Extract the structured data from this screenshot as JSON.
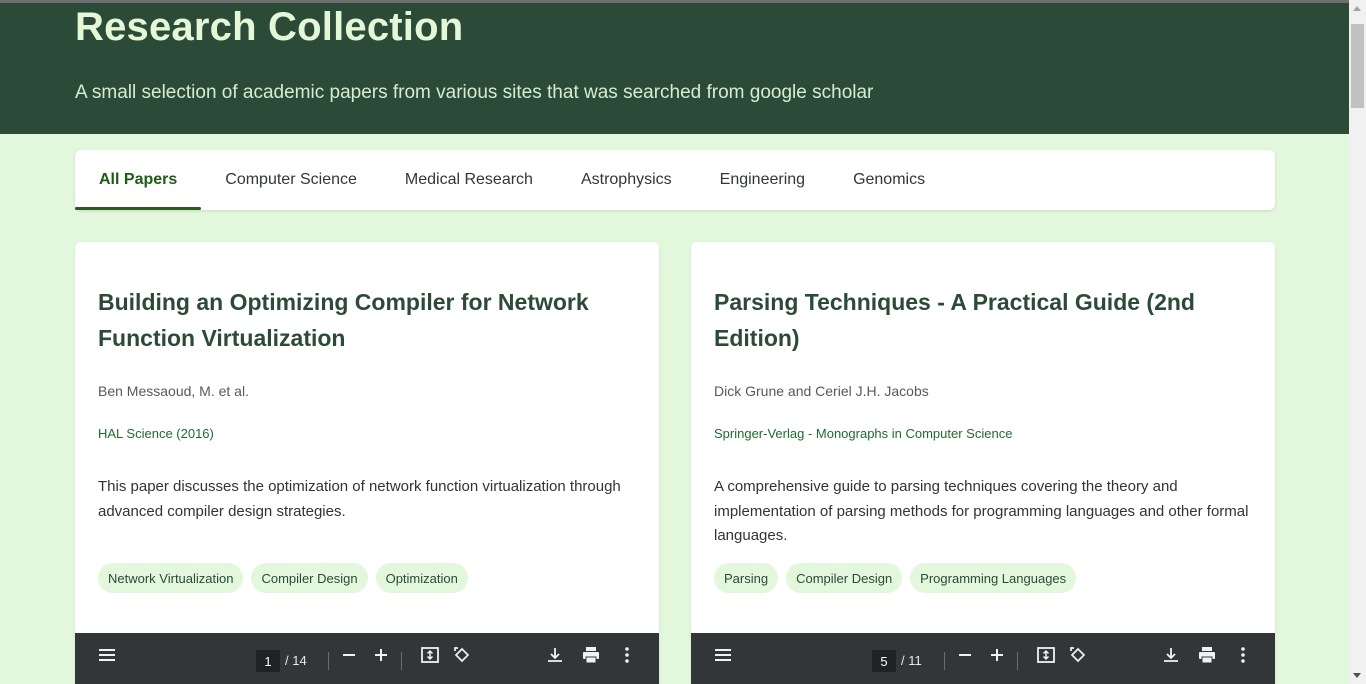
{
  "header": {
    "title": "Research Collection",
    "subtitle": "A small selection of academic papers from various sites that was searched from google scholar"
  },
  "tabs": [
    {
      "label": "All Papers",
      "active": true
    },
    {
      "label": "Computer Science"
    },
    {
      "label": "Medical Research"
    },
    {
      "label": "Astrophysics"
    },
    {
      "label": "Engineering"
    },
    {
      "label": "Genomics"
    }
  ],
  "papers": [
    {
      "title": "Building an Optimizing Compiler for Network Function Virtualization",
      "authors": "Ben Messaoud, M. et al.",
      "source": "HAL Science (2016)",
      "abstract": "This paper discusses the optimization of network function virtualization through advanced compiler design strategies.",
      "tags": [
        "Network Virtualization",
        "Compiler Design",
        "Optimization"
      ],
      "viewer": {
        "page": "1",
        "total": "/ 14"
      }
    },
    {
      "title": "Parsing Techniques - A Practical Guide (2nd Edition)",
      "authors": "Dick Grune and Ceriel J.H. Jacobs",
      "source": "Springer-Verlag - Monographs in Computer Science",
      "abstract": "A comprehensive guide to parsing techniques covering the theory and implementation of parsing methods for programming languages and other formal languages.",
      "tags": [
        "Parsing",
        "Compiler Design",
        "Programming Languages"
      ],
      "viewer": {
        "page": "5",
        "total": "/ 11"
      }
    }
  ],
  "colors": {
    "header_bg": "#2c4a38",
    "page_bg": "#e3f7dc",
    "accent": "#2d5a1f",
    "viewer_bg": "#323639"
  },
  "icons": {
    "viewer": [
      "menu-icon",
      "zoom-out-icon",
      "zoom-in-icon",
      "fit-page-icon",
      "rotate-icon",
      "download-icon",
      "print-icon",
      "more-icon"
    ]
  }
}
